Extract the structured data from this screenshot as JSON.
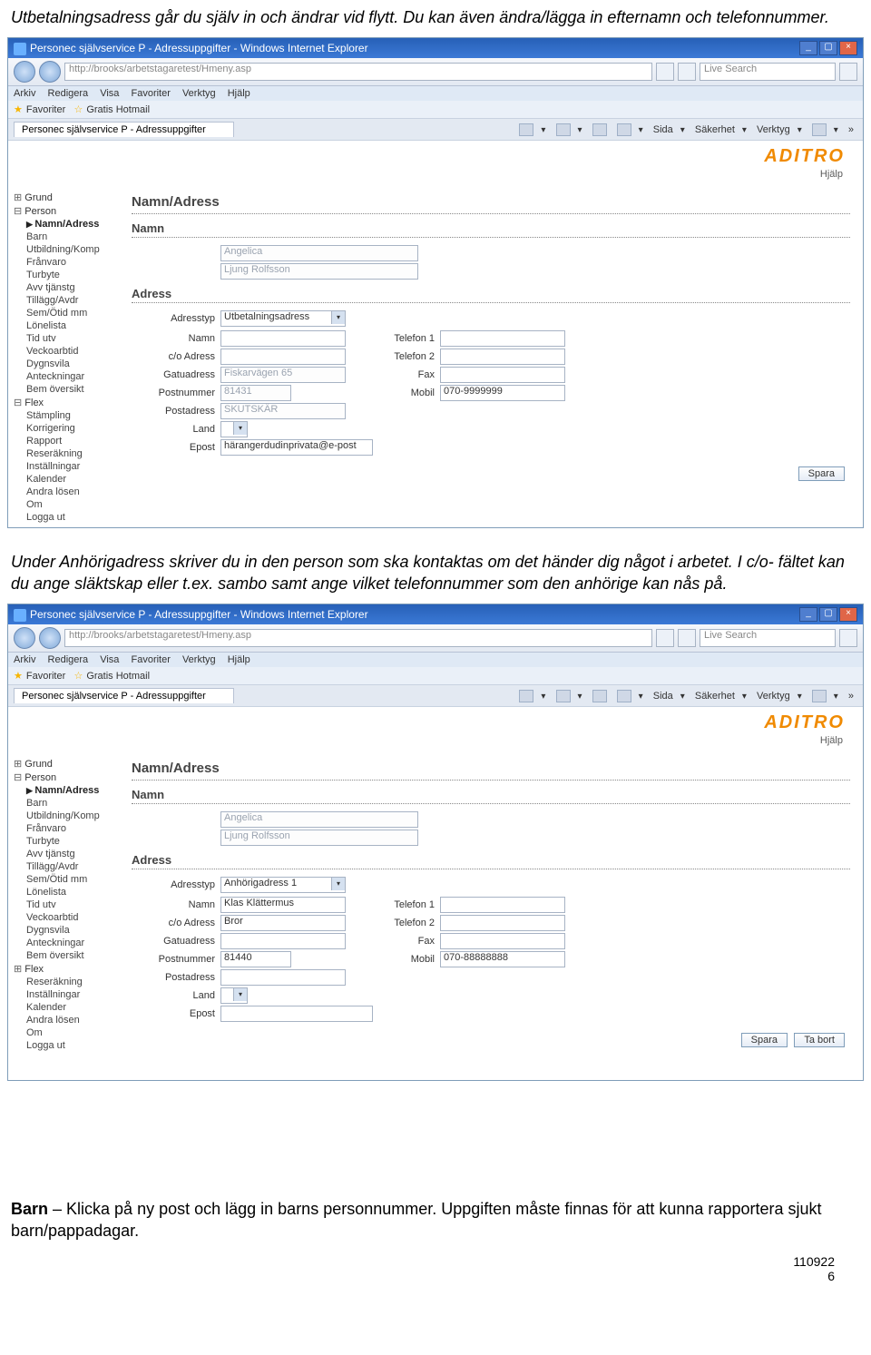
{
  "doc": {
    "intro": "Utbetalningsadress går du själv in och ändrar vid flytt. Du kan även ändra/lägga in efternamn och telefonnummer.",
    "mid": "Under Anhörigadress skriver du in den person som ska kontaktas om det händer dig något i arbetet. I c/o- fältet kan du ange släktskap eller t.ex. sambo samt ange vilket telefonnummer som den anhörige kan nås på.",
    "bottom_bold": "Barn",
    "bottom_rest": " – Klicka på ny post och lägg in barns personnummer. Uppgiften måste finnas för att kunna rapportera sjukt barn/pappadagar.",
    "date": "110922",
    "page": "6"
  },
  "chrome": {
    "title": "Personec självservice P - Adressuppgifter - Windows Internet Explorer",
    "url": "http://brooks/arbetstagaretest/Hmeny.asp",
    "search_placeholder": "Live Search",
    "menu": [
      "Arkiv",
      "Redigera",
      "Visa",
      "Favoriter",
      "Verktyg",
      "Hjälp"
    ],
    "fav_links": "Gratis Hotmail",
    "tab_label": "Personec självservice P - Adressuppgifter",
    "toolbar_items": {
      "sida": "Sida",
      "sakerhet": "Säkerhet",
      "verktyg": "Verktyg"
    }
  },
  "app": {
    "logo": "ADITRO",
    "help": "Hjälp",
    "sidebar1": {
      "roots": [
        "Grund"
      ],
      "open": "Person",
      "items": [
        "Namn/Adress",
        "Barn",
        "Utbildning/Komp",
        "Frånvaro",
        "Turbyte",
        "Avv tjänstg",
        "Tillägg/Avdr",
        "Sem/Ötid mm",
        "Lönelista",
        "Tid utv",
        "Veckoarbtid",
        "Dygnsvila",
        "Anteckningar",
        "Bem översikt"
      ],
      "open2": "Flex",
      "items2": [
        "Stämpling",
        "Korrigering",
        "Rapport",
        "Reseräkning",
        "Inställningar",
        "Kalender",
        "Andra lösen",
        "Om",
        "Logga ut"
      ]
    },
    "sidebar2": {
      "roots": [
        "Grund"
      ],
      "open": "Person",
      "items": [
        "Namn/Adress",
        "Barn",
        "Utbildning/Komp",
        "Frånvaro",
        "Turbyte",
        "Avv tjänstg",
        "Tillägg/Avdr",
        "Sem/Ötid mm",
        "Lönelista",
        "Tid utv",
        "Veckoarbtid",
        "Dygnsvila",
        "Anteckningar",
        "Bem översikt"
      ],
      "open2": "Flex",
      "items2": [
        "Reseräkning",
        "Inställningar",
        "Kalender",
        "Andra lösen",
        "Om",
        "Logga ut"
      ]
    },
    "section_title": "Namn/Adress",
    "sub_namn": "Namn",
    "sub_adress": "Adress",
    "labels": {
      "adresstyp": "Adresstyp",
      "namn": "Namn",
      "co": "c/o Adress",
      "gatu": "Gatuadress",
      "postnr": "Postnummer",
      "postadr": "Postadress",
      "land": "Land",
      "epost": "Epost",
      "tel1": "Telefon 1",
      "tel2": "Telefon 2",
      "fax": "Fax",
      "mobil": "Mobil"
    },
    "screen1": {
      "fornamn": "Angelica",
      "efternamn": "Ljung Rolfsson",
      "adresstyp": "Utbetalningsadress",
      "gatu": "Fiskarvägen 65",
      "postnr": "81431",
      "postadr": "SKUTSKÄR",
      "mobil": "070-9999999",
      "epost": "härangerdudinprivata@e-post",
      "btn_save": "Spara"
    },
    "screen2": {
      "fornamn": "Angelica",
      "efternamn": "Ljung Rolfsson",
      "adresstyp": "Anhörigadress 1",
      "namn": "Klas Klättermus",
      "co": "Bror",
      "postnr": "81440",
      "mobil": "070-88888888",
      "btn_save": "Spara",
      "btn_del": "Ta bort"
    }
  }
}
